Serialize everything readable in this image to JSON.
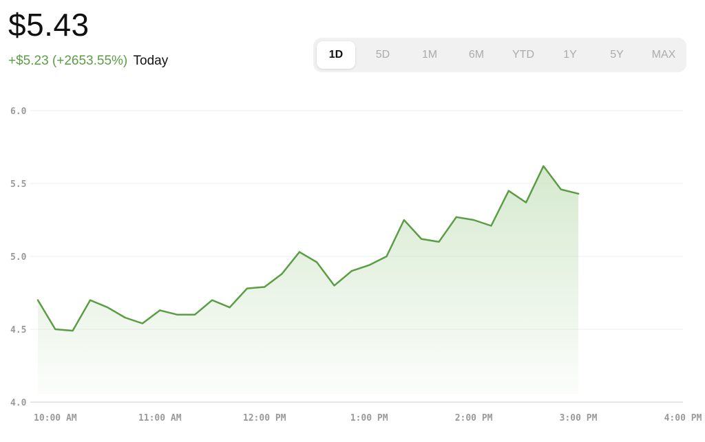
{
  "header": {
    "price": "$5.43",
    "change": "+$5.23 (+2653.55%)",
    "period": "Today"
  },
  "range_tabs": [
    {
      "label": "1D",
      "active": true
    },
    {
      "label": "5D",
      "active": false
    },
    {
      "label": "1M",
      "active": false
    },
    {
      "label": "6M",
      "active": false
    },
    {
      "label": "YTD",
      "active": false
    },
    {
      "label": "1Y",
      "active": false
    },
    {
      "label": "5Y",
      "active": false
    },
    {
      "label": "MAX",
      "active": false
    }
  ],
  "colors": {
    "line": "#5a9d44",
    "fill": "#c8e2bf",
    "grid": "#ececec",
    "axis": "#cccccc"
  },
  "chart_data": {
    "type": "area",
    "title": "",
    "xlabel": "",
    "ylabel": "",
    "ylim": [
      4.0,
      6.0
    ],
    "y_ticks": [
      "6.0",
      "5.5",
      "5.0",
      "4.5",
      "4.0"
    ],
    "x_ticks": [
      {
        "label": "10:00 AM",
        "value": "10:00"
      },
      {
        "label": "11:00 AM",
        "value": "11:00"
      },
      {
        "label": "12:00 PM",
        "value": "12:00"
      },
      {
        "label": "1:00 PM",
        "value": "13:00"
      },
      {
        "label": "2:00 PM",
        "value": "14:00"
      },
      {
        "label": "3:00 PM",
        "value": "15:00"
      },
      {
        "label": "4:00 PM",
        "value": "16:00"
      }
    ],
    "x_range": [
      "09:50",
      "16:00"
    ],
    "grid": true,
    "series": [
      {
        "x": [
          "09:50",
          "10:00",
          "10:10",
          "10:20",
          "10:30",
          "10:40",
          "10:50",
          "11:00",
          "11:10",
          "11:20",
          "11:30",
          "11:40",
          "11:50",
          "12:00",
          "12:10",
          "12:20",
          "12:30",
          "12:40",
          "12:50",
          "13:00",
          "13:10",
          "13:20",
          "13:30",
          "13:40",
          "13:50",
          "14:00",
          "14:10",
          "14:20",
          "14:30",
          "14:40",
          "14:50",
          "15:00"
        ],
        "values": [
          4.7,
          4.5,
          4.49,
          4.7,
          4.65,
          4.58,
          4.54,
          4.63,
          4.6,
          4.6,
          4.7,
          4.65,
          4.78,
          4.79,
          4.88,
          5.03,
          4.96,
          4.8,
          4.9,
          4.94,
          5.0,
          5.25,
          5.12,
          5.1,
          5.27,
          5.25,
          5.21,
          5.45,
          5.37,
          5.62,
          5.46,
          5.43
        ]
      }
    ]
  }
}
